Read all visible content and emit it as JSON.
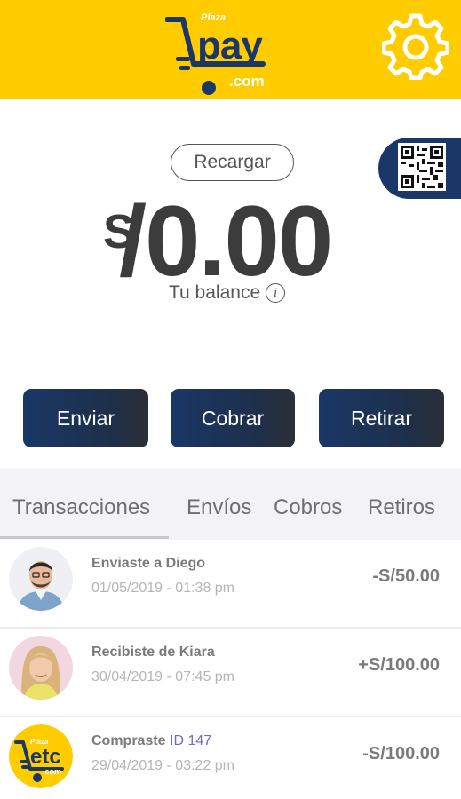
{
  "header": {
    "logo_plaza": "Plaza",
    "logo_pay": "pay",
    "logo_com": ".com",
    "settings_icon": "gear-icon",
    "brand_color": "#ffcc00",
    "accent_color": "#1b3767"
  },
  "recharge": {
    "label": "Recargar"
  },
  "qr": {
    "icon": "qr-code-icon"
  },
  "balance": {
    "currency": "S",
    "amount": "/0.00",
    "label": "Tu balance",
    "info_icon": "i"
  },
  "actions": {
    "send": "Enviar",
    "charge": "Cobrar",
    "withdraw": "Retirar"
  },
  "tabs": [
    "Transacciones",
    "Envíos",
    "Cobros",
    "Retiros"
  ],
  "transactions": [
    {
      "title": "Enviaste a Diego",
      "accent": "",
      "date": "01/05/2019 - 01:38 pm",
      "amount": "-S/50.00",
      "avatar": "man-avatar"
    },
    {
      "title": "Recibiste de Kiara",
      "accent": "",
      "date": "30/04/2019 - 07:45 pm",
      "amount": "+S/100.00",
      "avatar": "woman-avatar"
    },
    {
      "title": "Compraste ",
      "accent": "ID 147",
      "date": "29/04/2019 - 03:22 pm",
      "amount": "-S/100.00",
      "avatar": "plaza-etc-logo",
      "logo_plaza": "Plaza",
      "logo_etc": "etc",
      "logo_com": ".com"
    }
  ]
}
